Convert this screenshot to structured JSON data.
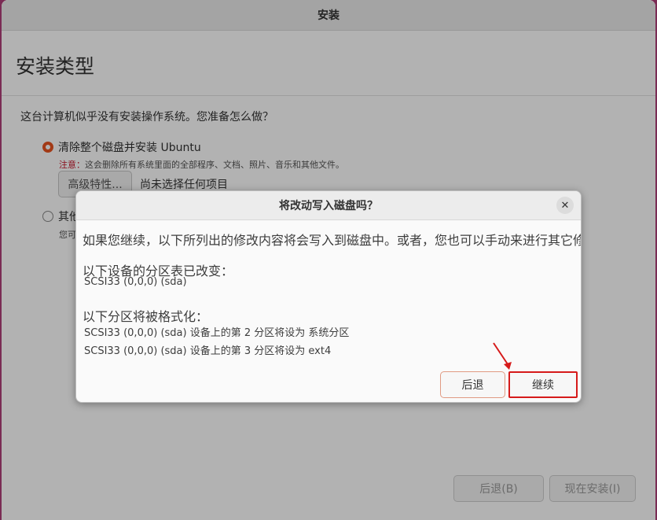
{
  "window": {
    "title": "安装",
    "heading": "安装类型"
  },
  "main": {
    "question": "这台计算机似乎没有安装操作系统。您准备怎么做？",
    "option_erase": {
      "label": "清除整个磁盘并安装 Ubuntu",
      "selected": true
    },
    "warning_prefix": "注意：",
    "warning_text": "这会删除所有系统里面的全部程序、文档、照片、音乐和其他文件。",
    "advanced_button": "高级特性...",
    "advanced_status": "尚未选择任何项目",
    "option_other": {
      "label": "其他",
      "selected": false
    },
    "other_note": "您可"
  },
  "footer": {
    "back_label": "后退(B)",
    "install_label": "现在安装(I)"
  },
  "dialog": {
    "title": "将改动写入磁盘吗？",
    "close_icon": "close-icon",
    "intro": "如果您继续，以下所列出的修改内容将会写入到磁盘中。或者，您也可以手动来进行其它修改。",
    "partition_table_heading": "以下设备的分区表已改变：",
    "partition_table_device": "SCSI33 (0,0,0) (sda)",
    "format_heading": "以下分区将被格式化：",
    "format_items": [
      "SCSI33 (0,0,0) (sda) 设备上的第 2 分区将设为 系统分区",
      "SCSI33 (0,0,0) (sda) 设备上的第 3 分区将设为 ext4"
    ],
    "back_label": "后退",
    "continue_label": "继续"
  },
  "colors": {
    "accent": "#e95420",
    "highlight": "#d61a1a",
    "background": "#7a2b54"
  }
}
